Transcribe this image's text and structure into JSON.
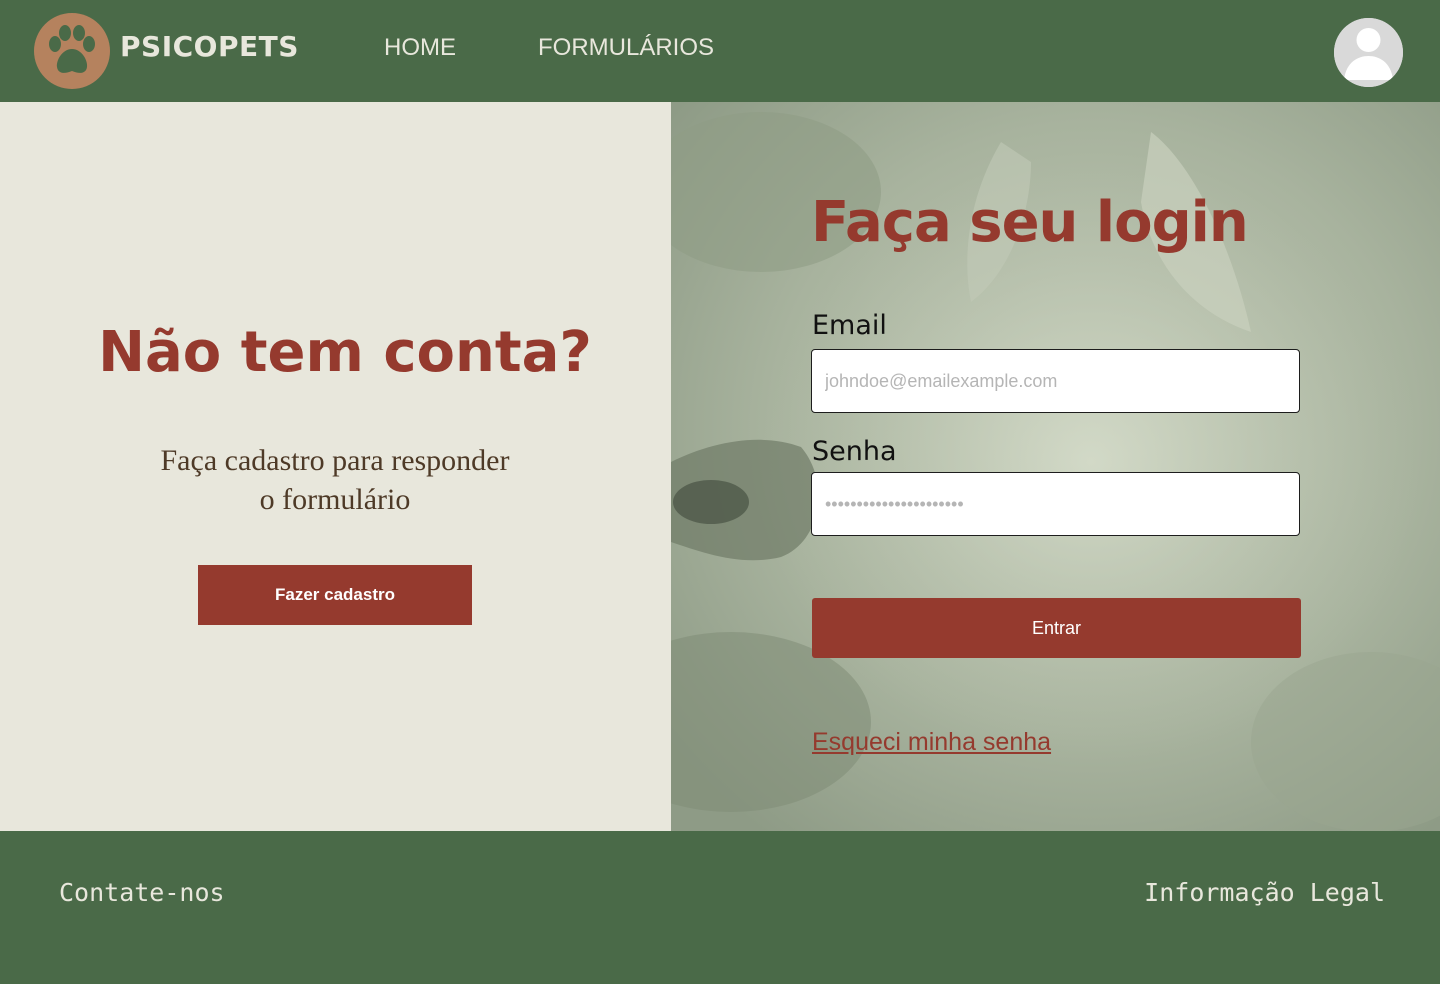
{
  "header": {
    "brand": "PSICOPETS",
    "logo_icon": "paw-icon",
    "nav": {
      "home": "HOME",
      "forms": "FORMULÁRIOS"
    },
    "avatar_icon": "user-avatar-icon"
  },
  "signup_panel": {
    "title": "Não tem conta?",
    "subtitle": "Faça cadastro para responder o formulário",
    "button_label": "Fazer cadastro"
  },
  "login_panel": {
    "title": "Faça seu login",
    "email_label": "Email",
    "email_placeholder": "johndoe@emailexample.com",
    "password_label": "Senha",
    "password_placeholder": "••••••••••••••••••••••",
    "submit_label": "Entrar",
    "forgot_link": "Esqueci minha senha"
  },
  "footer": {
    "contact": "Contate-nos",
    "legal": "Informação Legal"
  },
  "colors": {
    "primary_green": "#4a6a48",
    "accent_red": "#953a2e",
    "background_cream": "#e8e7dc",
    "logo_brown": "#b5825e"
  }
}
